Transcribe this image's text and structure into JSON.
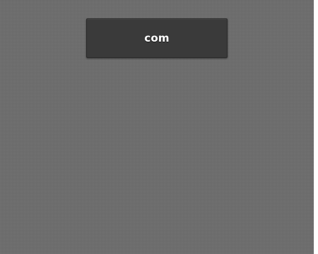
{
  "panel": {
    "background_color": "#6c6c6c",
    "texture": "linen"
  },
  "tld_card": {
    "label": "com",
    "background_color": "#3a3a3a",
    "text_color": "#ffffff"
  }
}
